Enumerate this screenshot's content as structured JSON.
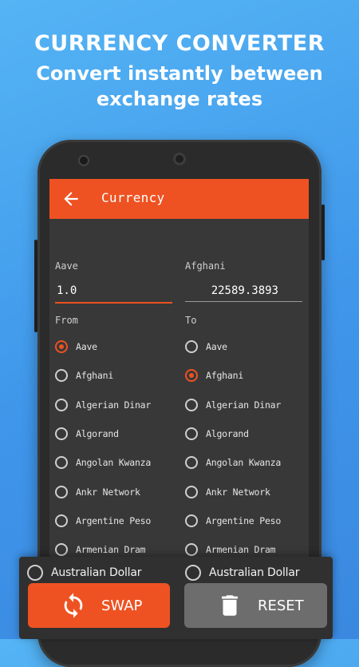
{
  "promo": {
    "line1": "CURRENCY CONVERTER",
    "line2": "Convert instantly between",
    "line3": "exchange rates"
  },
  "appbar": {
    "title": "Currency",
    "back_icon": "arrow-left-icon"
  },
  "from_field": {
    "label": "Aave",
    "value": "1.0"
  },
  "to_field": {
    "label": "Afghani",
    "value": "22589.3893"
  },
  "from_list": {
    "title": "From",
    "selected": "Aave",
    "items": [
      "Aave",
      "Afghani",
      "Algerian Dinar",
      "Algorand",
      "Angolan Kwanza",
      "Ankr Network",
      "Argentine Peso",
      "Armenian Dram"
    ]
  },
  "to_list": {
    "title": "To",
    "selected": "Afghani",
    "items": [
      "Aave",
      "Afghani",
      "Algerian Dinar",
      "Algorand",
      "Angolan Kwanza",
      "Ankr Network",
      "Argentine Peso",
      "Armenian Dram"
    ]
  },
  "bottom": {
    "from_option": "Australian Dollar",
    "to_option": "Australian Dollar",
    "swap_label": "SWAP",
    "swap_icon": "swap-arrows-icon",
    "reset_label": "RESET",
    "reset_icon": "trash-icon"
  },
  "colors": {
    "accent": "#ee5222",
    "background": "#4aa3ef",
    "screen": "#383838",
    "reset_button": "#6d6d6d"
  }
}
